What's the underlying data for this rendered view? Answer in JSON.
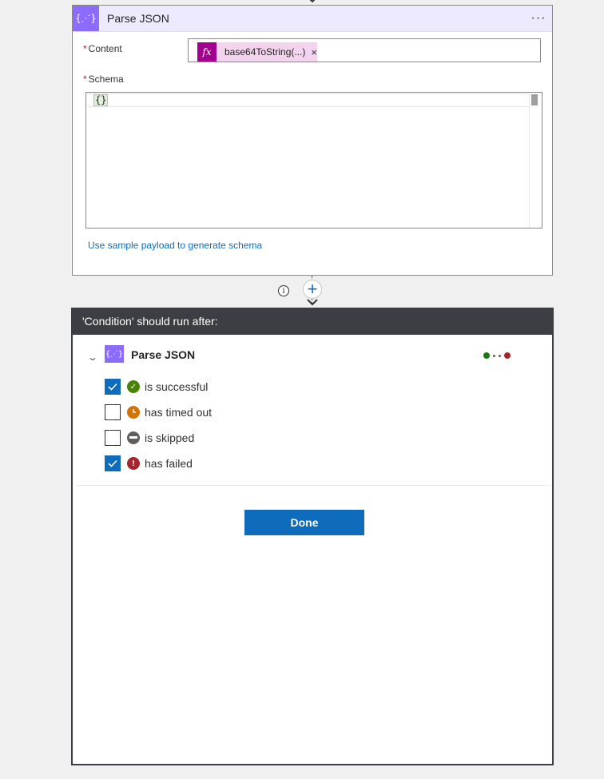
{
  "parse_json_card": {
    "title": "Parse JSON",
    "menu_label": "···",
    "icon_glyph": "{⋰}",
    "content_label": "Content",
    "content_token": {
      "icon_glyph": "fx",
      "text": "base64ToString(...)",
      "remove_glyph": "×"
    },
    "schema_label": "Schema",
    "schema_value": "{}",
    "sample_link": "Use sample payload to generate schema",
    "required_mark": "*"
  },
  "connector": {
    "info_glyph": "i",
    "add_glyph": "+"
  },
  "run_after_panel": {
    "header": "'Condition' should run after:",
    "action": {
      "name": "Parse JSON",
      "icon_glyph": "{⋰}"
    },
    "options": [
      {
        "label": "is successful",
        "checked": true,
        "status_color": "#498205",
        "status_glyph": "✓"
      },
      {
        "label": "has timed out",
        "checked": false,
        "status_color": "#d47300",
        "status_glyph": "◷"
      },
      {
        "label": "is skipped",
        "checked": false,
        "status_color": "#605e5c",
        "status_glyph": "—"
      },
      {
        "label": "has failed",
        "checked": true,
        "status_color": "#a4262c",
        "status_glyph": "!"
      }
    ],
    "done_label": "Done"
  },
  "colors": {
    "accent": "#0f6cbd",
    "action_purple": "#8c6cff",
    "expression_magenta": "#a4008f",
    "panel_header": "#3b3f44"
  }
}
